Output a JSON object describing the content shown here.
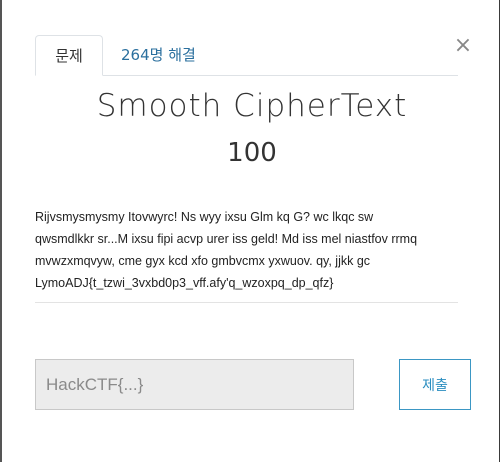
{
  "modal": {
    "tabs": [
      {
        "label": "문제"
      },
      {
        "label": "264명 해결"
      }
    ],
    "close_icon": "×",
    "title": "Smooth CipherText",
    "points": "100",
    "description": "Rijvsmysmysmy Itovwyrc! Ns wyy ixsu Glm kq G? wc lkqc sw qwsmdlkkr sr...M ixsu fipi acvp urer iss geld! Md iss mel niastfov rrmq mvwzxmqvyw, cme gyx kcd xfo gmbvcmx yxwuov. qy, jjkk gc LymoADJ{t_tzwi_3vxbd0p3_vff.afy'q_wzoxpq_dp_qfz}",
    "flag_input": {
      "value": "",
      "placeholder": "HackCTF{...}"
    },
    "submit_label": "제출"
  }
}
